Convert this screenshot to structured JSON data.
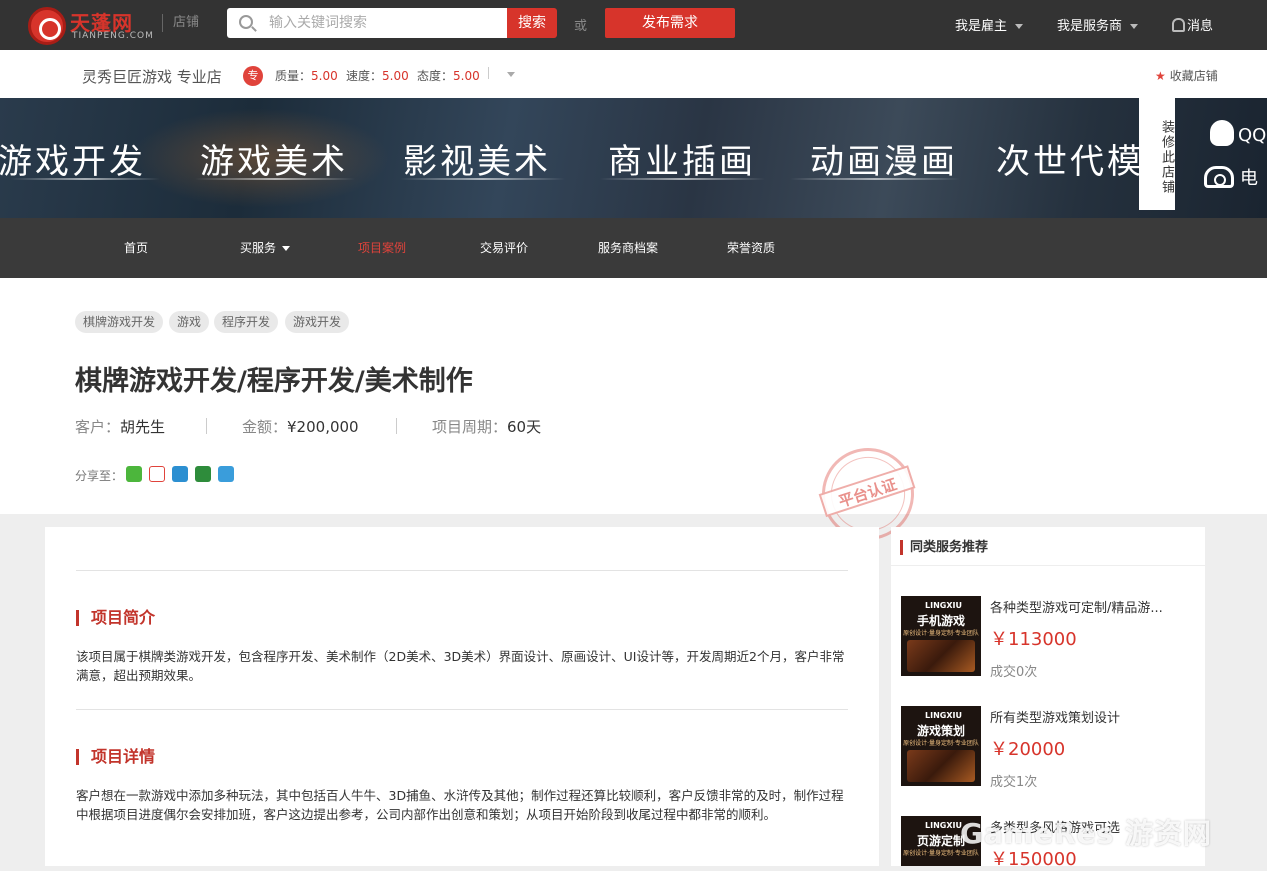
{
  "topbar": {
    "logo_text": "天蓬网",
    "logo_sub": "TIANPENG.COM",
    "shop_label": "店铺",
    "search_placeholder": "输入关键词搜索",
    "search_button": "搜索",
    "or_text": "或",
    "publish_button": "发布需求",
    "employer_link": "我是雇主",
    "provider_link": "我是服务商",
    "messages_link": "消息"
  },
  "shop": {
    "name": "灵秀巨匠游戏 专业店",
    "badge": "专",
    "quality_label": "质量：",
    "quality_value": "5.00",
    "speed_label": "速度：",
    "speed_value": "5.00",
    "attitude_label": "态度：",
    "attitude_value": "5.00",
    "favorite": "收藏店铺"
  },
  "banner": {
    "categories": [
      "游戏开发",
      "游戏美术",
      "影视美术",
      "商业插画",
      "动画漫画",
      "次世代模"
    ],
    "decorate_label": "装修此店铺",
    "qq": "QQ",
    "phone": "电"
  },
  "nav": {
    "items": [
      "首页",
      "买服务",
      "项目案例",
      "交易评价",
      "服务商档案",
      "荣誉资质"
    ]
  },
  "project": {
    "tags": [
      "棋牌游戏开发",
      "游戏",
      "程序开发",
      "游戏开发"
    ],
    "title": "棋牌游戏开发/程序开发/美术制作",
    "client_label": "客户：",
    "client_value": "胡先生",
    "amount_label": "金额：",
    "amount_value": "¥200,000",
    "period_label": "项目周期：",
    "period_value": "60天",
    "share_label": "分享至：",
    "stamp_text": "平台认证"
  },
  "content": {
    "intro_title": "项目简介",
    "intro_text": "该项目属于棋牌类游戏开发，包含程序开发、美术制作（2D美术、3D美术）界面设计、原画设计、UI设计等，开发周期近2个月，客户非常满意，超出预期效果。",
    "detail_title": "项目详情",
    "detail_text": "客户想在一款游戏中添加多种玩法，其中包括百人牛牛、3D捕鱼、水浒传及其他；制作过程还算比较顺利，客户反馈非常的及时，制作过程中根据项目进度偶尔会安排加班，客户这边提出参考，公司内部作出创意和策划；从项目开始阶段到收尾过程中都非常的顺利。"
  },
  "sidebar": {
    "title": "同类服务推荐",
    "items": [
      {
        "thumb_logo": "LINGXIU",
        "thumb_title": "手机游戏",
        "thumb_sub": "原创设计·量身定制·专业团队",
        "name": "各种类型游戏可定制/精品游...",
        "price": "￥113000",
        "deals": "成交0次"
      },
      {
        "thumb_logo": "LINGXIU",
        "thumb_title": "游戏策划",
        "thumb_sub": "原创设计·量身定制·专业团队",
        "name": "所有类型游戏策划设计",
        "price": "￥20000",
        "deals": "成交1次"
      },
      {
        "thumb_logo": "LINGXIU",
        "thumb_title": "页游定制",
        "thumb_sub": "原创设计·量身定制·专业团队",
        "name": "多类型多风格游戏可选",
        "price": "￥150000",
        "deals": ""
      }
    ]
  },
  "watermark": "GameRes 游资网",
  "colors": {
    "brand_red": "#d7342b",
    "topbar_bg": "#333333",
    "nav_bg": "#3a3a3a"
  }
}
